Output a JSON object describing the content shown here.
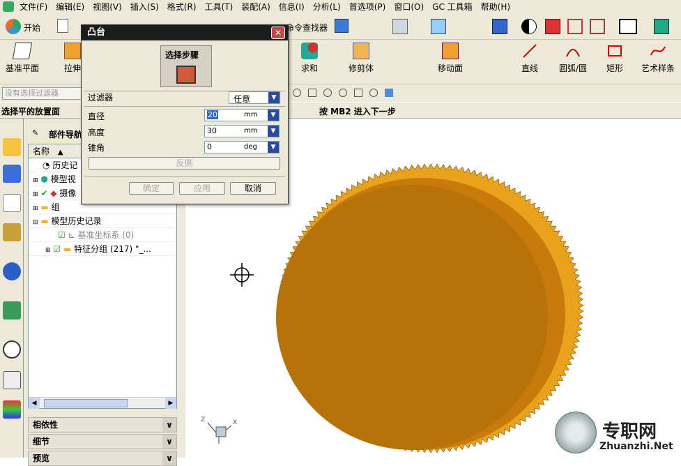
{
  "menu": [
    "文件(F)",
    "编辑(E)",
    "视图(V)",
    "插入(S)",
    "格式(R)",
    "工具(T)",
    "装配(A)",
    "信息(I)",
    "分析(L)",
    "首选项(P)",
    "窗口(O)",
    "GC 工具箱",
    "帮助(H)"
  ],
  "toolbar1": {
    "start_label": "开始",
    "cmd_finder": "命令查找器"
  },
  "toolbar2": {
    "datum_plane": "基准平面",
    "extrude": "拉伸",
    "unite": "求和",
    "trim_body": "修剪体",
    "move_face": "移动面",
    "line": "直线",
    "arc": "圆弧/圆",
    "rect": "矩形",
    "spline": "艺术样条"
  },
  "selection_filter_placeholder": "没有选择过滤器",
  "cue_line": "选择平的放置面",
  "status_line": "按 MB2 进入下一步",
  "navigator": {
    "title": "部件导航器",
    "col_name": "名称",
    "items": [
      {
        "label": "历史记"
      },
      {
        "label": "模型视"
      },
      {
        "label": "摄像"
      },
      {
        "label": "组"
      },
      {
        "label": "模型历史记录"
      },
      {
        "label": "基准坐标系 (0)"
      },
      {
        "label": "特征分组 (217) \"_..."
      }
    ]
  },
  "panels": [
    "相依性",
    "细节",
    "预览"
  ],
  "dialog": {
    "title": "凸台",
    "section": "选择步骤",
    "filter_label": "过滤器",
    "filter_value": "任意",
    "diameter_label": "直径",
    "diameter_value": "20",
    "diameter_unit": "mm",
    "height_label": "高度",
    "height_value": "30",
    "height_unit": "mm",
    "taper_label": "锥角",
    "taper_value": "0",
    "taper_unit": "deg",
    "reverse_label": "反侧",
    "ok_label": "确定",
    "apply_label": "应用",
    "cancel_label": "取消"
  },
  "watermark": {
    "cn": "专职网",
    "en": "Zhuanzhi.Net"
  },
  "colors": {
    "gear": "#c87a0a",
    "gear_face": "#b7720a",
    "accent": "#2d4b9a"
  }
}
